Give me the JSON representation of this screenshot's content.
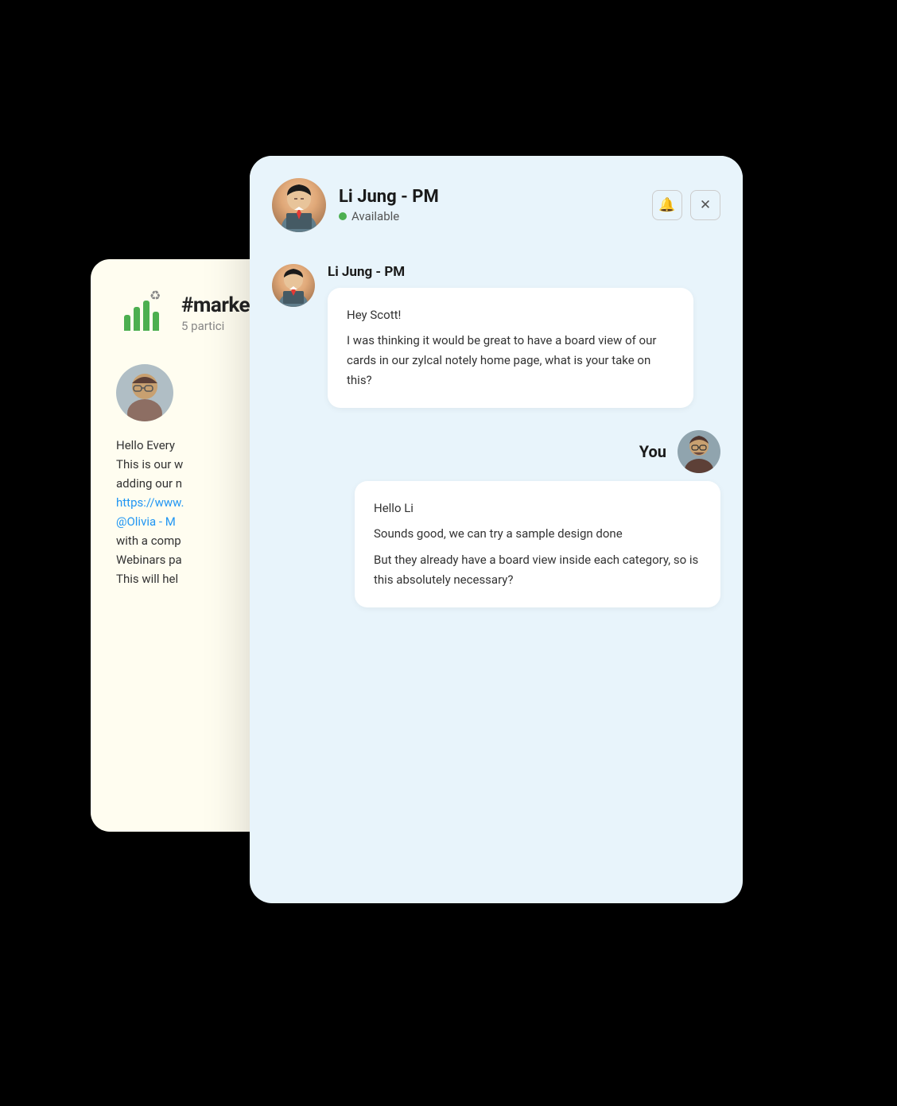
{
  "scene": {
    "background_card": {
      "channel_name": "#marke",
      "channel_participants": "5 partici",
      "back_message": {
        "greeting": "Hello Every",
        "line1": "This is our w",
        "line2": "adding our n",
        "link": "https://www.",
        "mention": "@Olivia - M",
        "line3": "with a comp",
        "line4": "Webinars pa",
        "line5": "This will hel"
      }
    },
    "chat_card": {
      "header": {
        "name": "Li Jung - PM",
        "status": "Available",
        "bell_label": "🔔",
        "close_label": "✕"
      },
      "messages": [
        {
          "id": "msg1",
          "sender": "Li Jung - PM",
          "side": "left",
          "lines": [
            "Hey Scott!",
            "I was thinking it would be great to have a board view of our cards in our zylcal notely home page, what is your take on this?"
          ]
        },
        {
          "id": "msg2",
          "sender": "You",
          "side": "right",
          "lines": [
            "Hello Li",
            "Sounds good, we can try a sample design done",
            "But they already have a board view inside each category, so is this absolutely necessary?"
          ]
        }
      ]
    }
  }
}
